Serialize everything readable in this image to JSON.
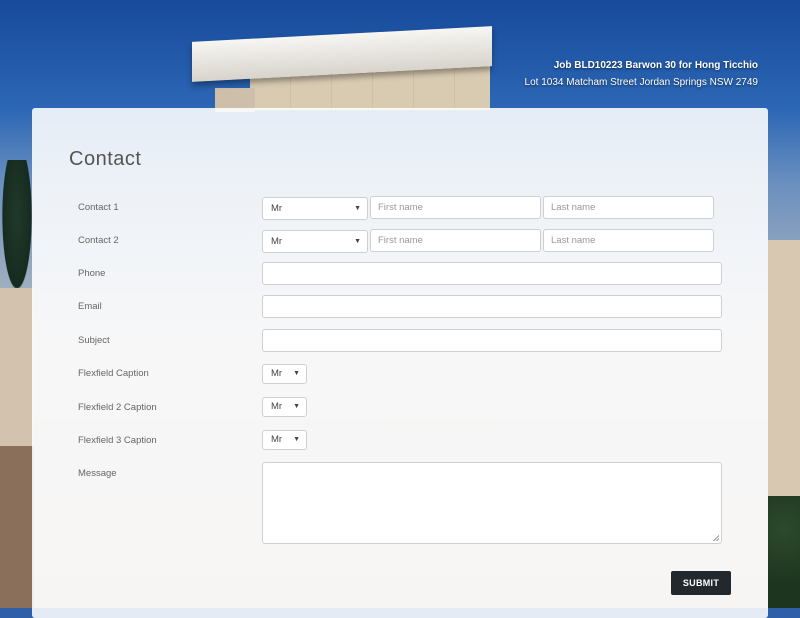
{
  "header": {
    "job_title": "Job BLD10223 Barwon 30 for Hong Ticchio",
    "job_address": "Lot 1034 Matcham Street Jordan Springs NSW 2749"
  },
  "form": {
    "title": "Contact",
    "contact1": {
      "label": "Contact 1",
      "title_value": "Mr",
      "first_placeholder": "First name",
      "last_placeholder": "Last name"
    },
    "contact2": {
      "label": "Contact 2",
      "title_value": "Mr",
      "first_placeholder": "First name",
      "last_placeholder": "Last name"
    },
    "phone": {
      "label": "Phone",
      "value": ""
    },
    "email": {
      "label": "Email",
      "value": ""
    },
    "subject": {
      "label": "Subject",
      "value": ""
    },
    "flexfield1": {
      "label": "Flexfield Caption",
      "value": "Mr"
    },
    "flexfield2": {
      "label": "Flexfield 2 Caption",
      "value": "Mr"
    },
    "flexfield3": {
      "label": "Flexfield 3 Caption",
      "value": "Mr"
    },
    "message": {
      "label": "Message",
      "value": ""
    },
    "submit_label": "SUBMIT"
  },
  "icons": {
    "dropdown": "caret-down-icon",
    "resize": "resize-handle-icon"
  },
  "colors": {
    "panel_bg": "#ffffff",
    "submit_bg": "#23282c",
    "text": "#666666"
  }
}
